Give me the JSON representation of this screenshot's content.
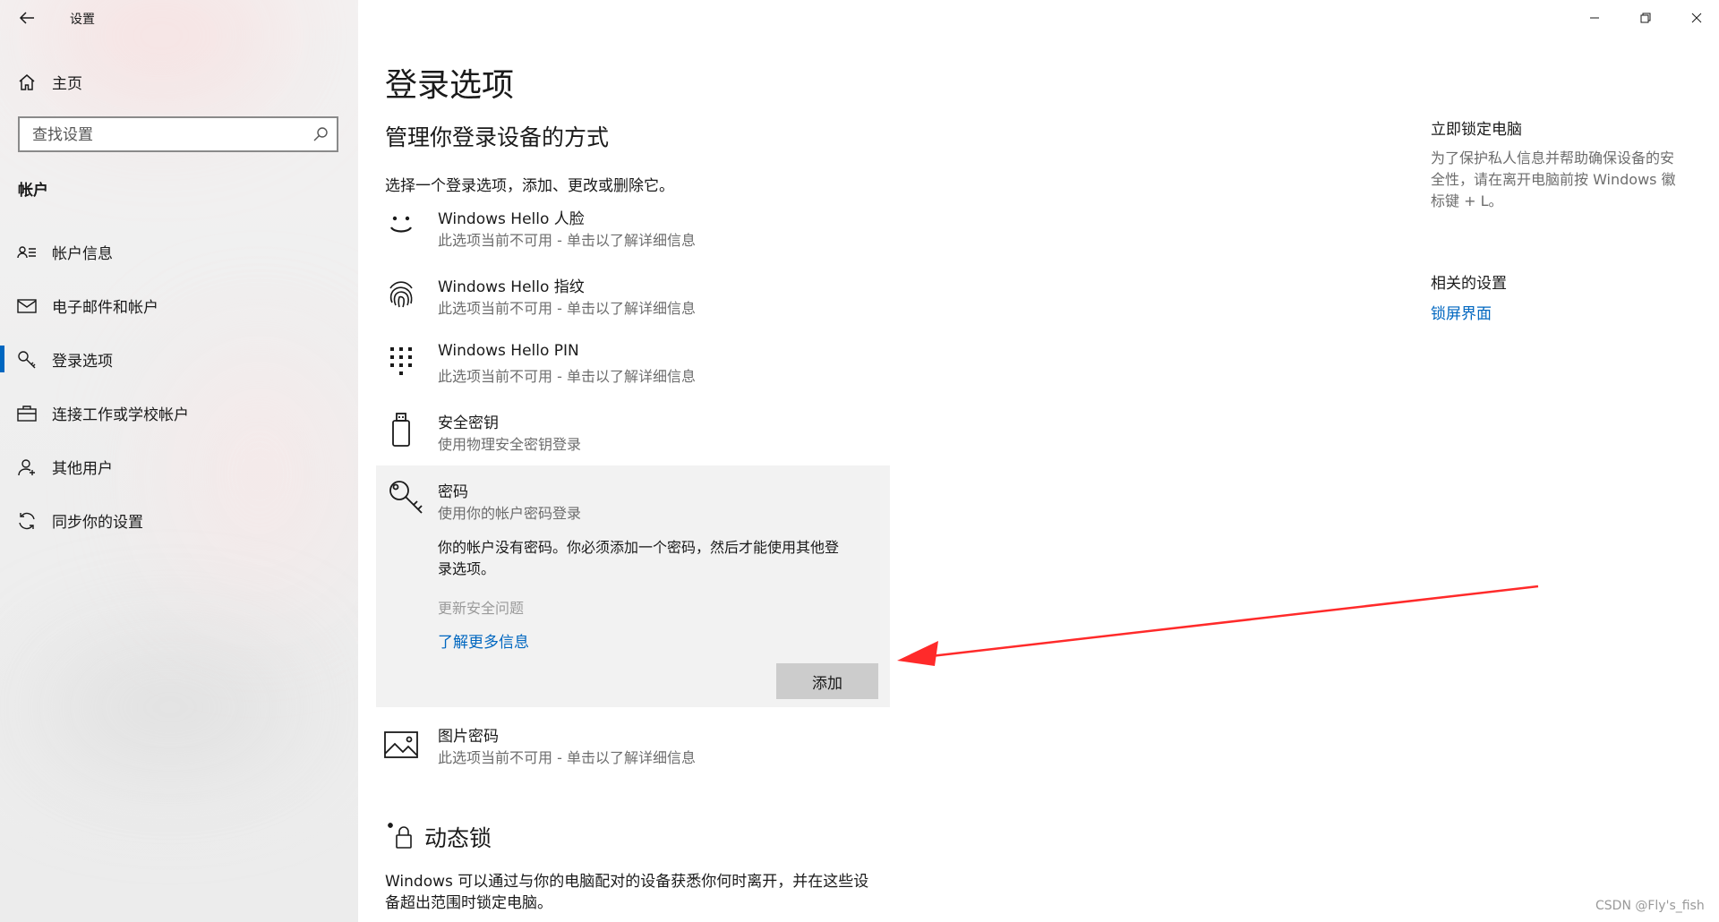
{
  "window": {
    "title": "设置",
    "watermark": "CSDN @Fly's_fish"
  },
  "sidebar": {
    "home_label": "主页",
    "search_placeholder": "查找设置",
    "section_heading": "帐户",
    "items": [
      {
        "label": "帐户信息",
        "icon": "account-info-icon"
      },
      {
        "label": "电子邮件和帐户",
        "icon": "mail-icon"
      },
      {
        "label": "登录选项",
        "icon": "key-icon",
        "selected": true
      },
      {
        "label": "连接工作或学校帐户",
        "icon": "briefcase-icon"
      },
      {
        "label": "其他用户",
        "icon": "person-icon"
      },
      {
        "label": "同步你的设置",
        "icon": "sync-icon"
      }
    ]
  },
  "main": {
    "page_title": "登录选项",
    "subtitle": "管理你登录设备的方式",
    "intro": "选择一个登录选项，添加、更改或删除它。",
    "options": [
      {
        "name": "Windows Hello 人脸",
        "desc": "此选项当前不可用 - 单击以了解详细信息"
      },
      {
        "name": "Windows Hello 指纹",
        "desc": "此选项当前不可用 - 单击以了解详细信息"
      },
      {
        "name": "Windows Hello PIN",
        "desc": "此选项当前不可用 - 单击以了解详细信息"
      },
      {
        "name": "安全密钥",
        "desc": "使用物理安全密钥登录"
      }
    ],
    "password": {
      "name": "密码",
      "desc": "使用你的帐户密码登录",
      "message_line1": "你的帐户没有密码。你必须添加一个密码，然后才能使用其他登",
      "message_line2": "录选项。",
      "update_security_questions": "更新安全问题",
      "learn_more": "了解更多信息",
      "add_button": "添加"
    },
    "picture_password": {
      "name": "图片密码",
      "desc": "此选项当前不可用 - 单击以了解详细信息"
    },
    "dynamic_lock": {
      "title": "动态锁",
      "desc_line1": "Windows 可以通过与你的电脑配对的设备获悉你何时离开，并在这些设",
      "desc_line2": "备超出范围时锁定电脑。"
    }
  },
  "right_panel": {
    "lock_title": "立即锁定电脑",
    "lock_desc_line1": "为了保护私人信息并帮助确保设备的安",
    "lock_desc_line2": "全性，请在离开电脑前按 Windows 徽",
    "lock_desc_line3": "标键 + L。",
    "related_title": "相关的设置",
    "related_link": "锁屏界面"
  },
  "colors": {
    "accent": "#0067c0",
    "arrow": "#ff2a2a",
    "panel_bg": "#f2f2f2",
    "button_bg": "#cccccc"
  }
}
